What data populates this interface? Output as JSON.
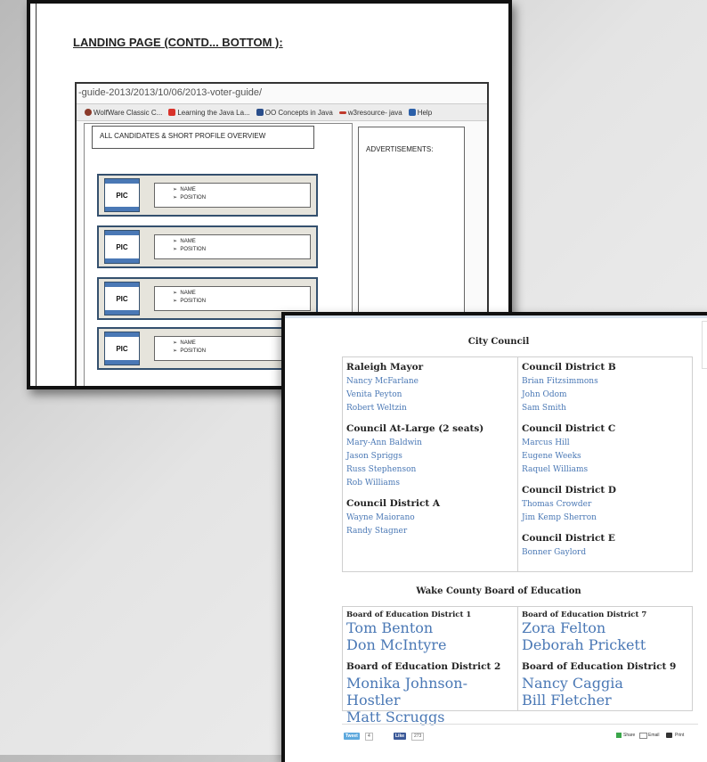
{
  "doc1": {
    "heading": "LANDING PAGE (CONTD... BOTTOM ):",
    "browser": {
      "url": "-guide-2013/2013/10/06/2013-voter-guide/",
      "bookmarks": [
        {
          "label": "WolfWare Classic C...",
          "color": "#8b3a2a"
        },
        {
          "label": "Learning the Java La...",
          "color": "#d9322a"
        },
        {
          "label": "OO Concepts in Java",
          "color": "#2a4e8b"
        },
        {
          "label": "w3resource- java",
          "color": "#c0392b"
        },
        {
          "label": "Help",
          "color": "#2b5fa8"
        }
      ]
    },
    "wireframe": {
      "header": "ALL CANDIDATES & SHORT PROFILE OVERVIEW",
      "ads": "ADVERTISEMENTS:",
      "rows": [
        {
          "pic": "PIC",
          "name": "NAME",
          "position": "POSITION"
        },
        {
          "pic": "PIC",
          "name": "NAME",
          "position": "POSITION"
        },
        {
          "pic": "PIC",
          "name": "NAME",
          "position": "POSITION"
        },
        {
          "pic": "PIC",
          "name": "NAME",
          "position": "POSITION"
        }
      ]
    }
  },
  "doc2": {
    "city_council": {
      "title": "City Council",
      "left": [
        {
          "race": "Raleigh Mayor",
          "candidates": [
            "Nancy McFarlane",
            "Venita Peyton",
            "Robert Weltzin"
          ]
        },
        {
          "race": "Council At-Large (2 seats)",
          "candidates": [
            "Mary-Ann Baldwin",
            "Jason Spriggs",
            "Russ Stephenson",
            "Rob Williams"
          ]
        },
        {
          "race": "Council District A",
          "candidates": [
            "Wayne Maiorano",
            "Randy Stagner"
          ]
        }
      ],
      "right": [
        {
          "race": "Council District B",
          "candidates": [
            "Brian Fitzsimmons",
            "John Odom",
            "Sam Smith"
          ]
        },
        {
          "race": "Council District C",
          "candidates": [
            "Marcus Hill",
            "Eugene Weeks",
            "Raquel Williams"
          ]
        },
        {
          "race": "Council District D",
          "candidates": [
            "Thomas Crowder",
            "Jim Kemp Sherron"
          ]
        },
        {
          "race": "Council District E",
          "candidates": [
            "Bonner Gaylord"
          ]
        }
      ]
    },
    "board_of_education": {
      "title": "Wake County Board of Education",
      "left": [
        {
          "race": "Board of Education District 1",
          "candidates": [
            "Tom Benton",
            "Don McIntyre"
          ]
        },
        {
          "race": "Board of Education District 2",
          "candidates": [
            "Monika Johnson-Hostler",
            "Matt Scruggs"
          ]
        }
      ],
      "right": [
        {
          "race": "Board of Education District 7",
          "candidates": [
            "Zora Felton",
            "Deborah Prickett"
          ]
        },
        {
          "race": "Board of Education District 9",
          "candidates": [
            "Nancy Caggia",
            "Bill Fletcher"
          ]
        }
      ]
    },
    "share_bar": {
      "tweet": "Tweet",
      "tweet_count": "4",
      "like": "Like",
      "like_count": "273",
      "share": "Share",
      "email": "Email",
      "print": "Print"
    }
  }
}
